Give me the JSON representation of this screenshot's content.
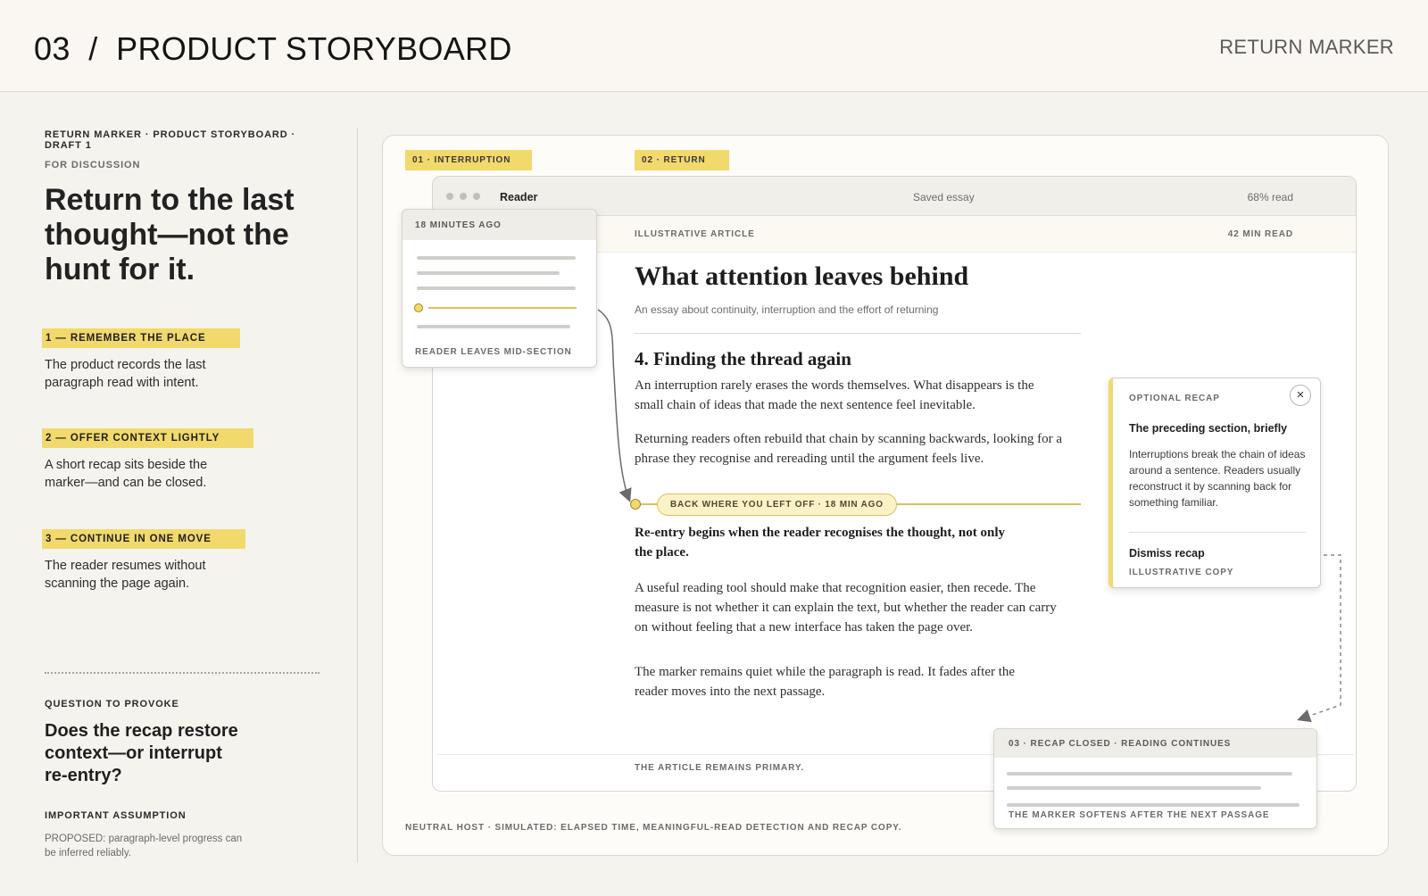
{
  "header": {
    "title": "03  /  PRODUCT STORYBOARD",
    "right_label": "RETURN MARKER"
  },
  "left": {
    "eyebrow": "RETURN MARKER · PRODUCT STORYBOARD · DRAFT 1",
    "eyebrow_sub": "FOR DISCUSSION",
    "headline": "Return to the last thought—not the hunt for it.",
    "steps": [
      {
        "tag": "1 — REMEMBER THE PLACE",
        "desc": "The product records the last paragraph read with intent."
      },
      {
        "tag": "2 — OFFER CONTEXT LIGHTLY",
        "desc": "A short recap sits beside the marker—and can be closed."
      },
      {
        "tag": "3 — CONTINUE IN ONE MOVE",
        "desc": "The reader resumes without scanning the page again."
      }
    ],
    "question_label": "QUESTION TO PROVOKE",
    "question": "Does the recap restore context—or interrupt re-entry?",
    "assumption_label": "IMPORTANT ASSUMPTION",
    "assumption": "PROPOSED: paragraph-level progress can be inferred reliably."
  },
  "stage": {
    "phase_1": "01 · INTERRUPTION",
    "phase_2": "02 · RETURN",
    "footer": "NEUTRAL HOST · SIMULATED: ELAPSED TIME, MEANINGFUL-READ DETECTION AND RECAP COPY.",
    "window": {
      "app_name": "Reader",
      "doc_label": "Saved essay",
      "progress": "68% read",
      "meta_left": "ILLUSTRATIVE ARTICLE",
      "meta_right": "42 MIN READ",
      "title": "What attention leaves behind",
      "subtitle": "An essay about continuity, interruption and the effort of returning",
      "section": "4. Finding the thread again",
      "para_1": "An interruption rarely erases the words themselves. What disappears is the small chain of ideas that made the next sentence feel inevitable.",
      "para_2": "Returning readers often rebuild that chain by scanning backwards, looking for a phrase they recognise and rereading until the argument feels live.",
      "marker": "BACK WHERE YOU LEFT OFF · 18 MIN AGO",
      "para_3": "Re-entry begins when the reader recognises the thought, not only the place.",
      "para_4": "A useful reading tool should make that recognition easier, then recede. The measure is not whether it can explain the text, but whether the reader can carry on without feeling that a new interface has taken the page over.",
      "para_5": "The marker remains quiet while the paragraph is read. It fades after the reader moves into the next passage.",
      "bottom_note": "THE ARTICLE REMAINS PRIMARY."
    },
    "interruption_card": {
      "header": "18 MINUTES AGO",
      "footer": "READER LEAVES MID-SECTION"
    },
    "recap": {
      "eyebrow": "OPTIONAL RECAP",
      "close_icon": "×",
      "heading": "The preceding section, briefly",
      "body": "Interruptions break the chain of ideas around a sentence. Readers usually reconstruct it by scanning back for something familiar.",
      "dismiss": "Dismiss recap",
      "note": "ILLUSTRATIVE COPY"
    },
    "closed_card": {
      "header": "03 · RECAP CLOSED · READING CONTINUES",
      "footer": "THE MARKER SOFTENS AFTER THE NEXT PASSAGE"
    }
  },
  "colors": {
    "accent_yellow": "#f1d96c",
    "marker_line": "#d8c35c",
    "background": "#f5f3ee"
  }
}
